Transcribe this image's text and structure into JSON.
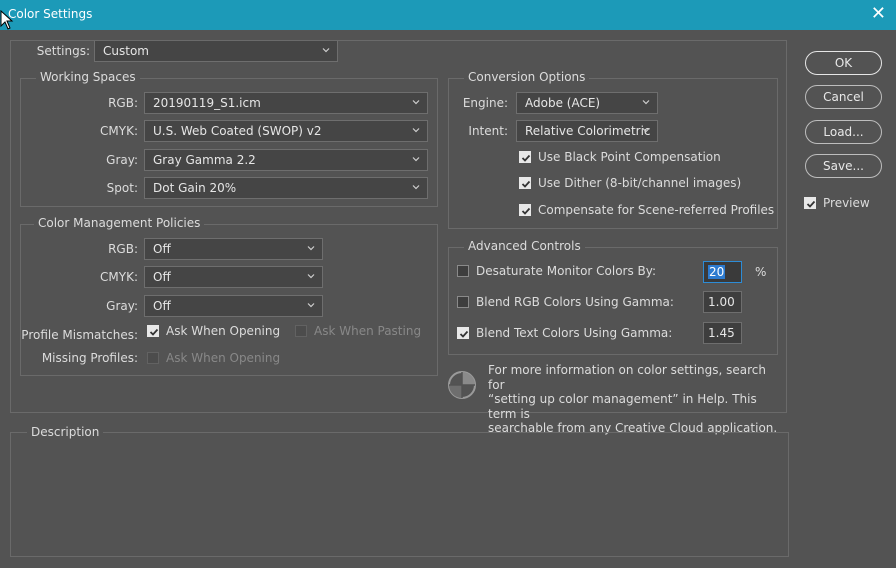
{
  "window": {
    "title": "Color Settings"
  },
  "settings": {
    "label": "Settings:",
    "value": "Custom"
  },
  "working_spaces": {
    "title": "Working Spaces",
    "rgb": {
      "label": "RGB:",
      "value": "20190119_S1.icm"
    },
    "cmyk": {
      "label": "CMYK:",
      "value": "U.S. Web Coated (SWOP) v2"
    },
    "gray": {
      "label": "Gray:",
      "value": "Gray Gamma 2.2"
    },
    "spot": {
      "label": "Spot:",
      "value": "Dot Gain 20%"
    }
  },
  "policies": {
    "title": "Color Management Policies",
    "rgb": {
      "label": "RGB:",
      "value": "Off"
    },
    "cmyk": {
      "label": "CMYK:",
      "value": "Off"
    },
    "gray": {
      "label": "Gray:",
      "value": "Off"
    },
    "profile_mismatches": {
      "label": "Profile Mismatches:",
      "ask_opening": {
        "label": "Ask When Opening",
        "checked": true,
        "enabled": true
      },
      "ask_pasting": {
        "label": "Ask When Pasting",
        "checked": false,
        "enabled": false
      }
    },
    "missing_profiles": {
      "label": "Missing Profiles:",
      "ask_opening": {
        "label": "Ask When Opening",
        "checked": false,
        "enabled": false
      }
    }
  },
  "conversion": {
    "title": "Conversion Options",
    "engine": {
      "label": "Engine:",
      "value": "Adobe (ACE)"
    },
    "intent": {
      "label": "Intent:",
      "value": "Relative Colorimetric"
    },
    "black_point": {
      "label": "Use Black Point Compensation",
      "checked": true
    },
    "dither": {
      "label": "Use Dither (8-bit/channel images)",
      "checked": true
    },
    "scene": {
      "label": "Compensate for Scene-referred Profiles",
      "checked": true
    }
  },
  "advanced": {
    "title": "Advanced Controls",
    "desaturate": {
      "label": "Desaturate Monitor Colors By:",
      "checked": false,
      "value": "20",
      "unit": "%"
    },
    "blend_rgb": {
      "label": "Blend RGB Colors Using Gamma:",
      "checked": false,
      "value": "1.00"
    },
    "blend_text": {
      "label": "Blend Text Colors Using Gamma:",
      "checked": true,
      "value": "1.45"
    }
  },
  "info_text": {
    "line1": "For more information on color settings, search for",
    "line2": "“setting up color management” in Help. This term is",
    "line3": "searchable from any Creative Cloud application."
  },
  "description": {
    "title": "Description"
  },
  "buttons": {
    "ok": "OK",
    "cancel": "Cancel",
    "load": "Load...",
    "save": "Save..."
  },
  "preview": {
    "label": "Preview",
    "checked": true
  },
  "colors": {
    "titlebar": "#1c9ab8",
    "background": "#535353",
    "accent": "#2d7bd0"
  }
}
